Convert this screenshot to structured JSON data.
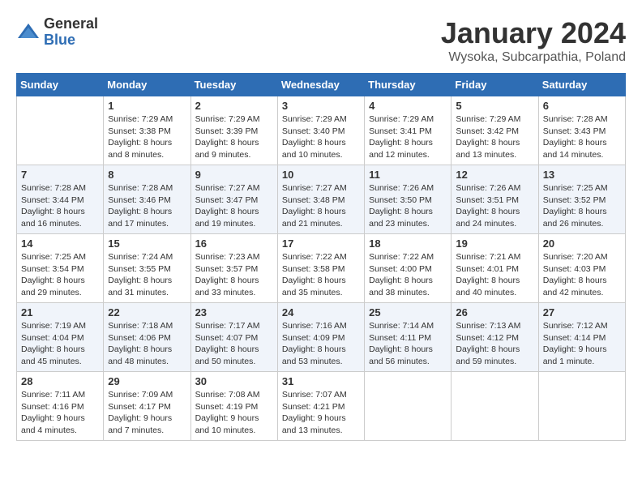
{
  "logo": {
    "general": "General",
    "blue": "Blue"
  },
  "title": {
    "month": "January 2024",
    "location": "Wysoka, Subcarpathia, Poland"
  },
  "weekdays": [
    "Sunday",
    "Monday",
    "Tuesday",
    "Wednesday",
    "Thursday",
    "Friday",
    "Saturday"
  ],
  "weeks": [
    {
      "days": [
        {
          "date": "",
          "info": ""
        },
        {
          "date": "1",
          "info": "Sunrise: 7:29 AM\nSunset: 3:38 PM\nDaylight: 8 hours\nand 8 minutes."
        },
        {
          "date": "2",
          "info": "Sunrise: 7:29 AM\nSunset: 3:39 PM\nDaylight: 8 hours\nand 9 minutes."
        },
        {
          "date": "3",
          "info": "Sunrise: 7:29 AM\nSunset: 3:40 PM\nDaylight: 8 hours\nand 10 minutes."
        },
        {
          "date": "4",
          "info": "Sunrise: 7:29 AM\nSunset: 3:41 PM\nDaylight: 8 hours\nand 12 minutes."
        },
        {
          "date": "5",
          "info": "Sunrise: 7:29 AM\nSunset: 3:42 PM\nDaylight: 8 hours\nand 13 minutes."
        },
        {
          "date": "6",
          "info": "Sunrise: 7:28 AM\nSunset: 3:43 PM\nDaylight: 8 hours\nand 14 minutes."
        }
      ]
    },
    {
      "days": [
        {
          "date": "7",
          "info": "Sunrise: 7:28 AM\nSunset: 3:44 PM\nDaylight: 8 hours\nand 16 minutes."
        },
        {
          "date": "8",
          "info": "Sunrise: 7:28 AM\nSunset: 3:46 PM\nDaylight: 8 hours\nand 17 minutes."
        },
        {
          "date": "9",
          "info": "Sunrise: 7:27 AM\nSunset: 3:47 PM\nDaylight: 8 hours\nand 19 minutes."
        },
        {
          "date": "10",
          "info": "Sunrise: 7:27 AM\nSunset: 3:48 PM\nDaylight: 8 hours\nand 21 minutes."
        },
        {
          "date": "11",
          "info": "Sunrise: 7:26 AM\nSunset: 3:50 PM\nDaylight: 8 hours\nand 23 minutes."
        },
        {
          "date": "12",
          "info": "Sunrise: 7:26 AM\nSunset: 3:51 PM\nDaylight: 8 hours\nand 24 minutes."
        },
        {
          "date": "13",
          "info": "Sunrise: 7:25 AM\nSunset: 3:52 PM\nDaylight: 8 hours\nand 26 minutes."
        }
      ]
    },
    {
      "days": [
        {
          "date": "14",
          "info": "Sunrise: 7:25 AM\nSunset: 3:54 PM\nDaylight: 8 hours\nand 29 minutes."
        },
        {
          "date": "15",
          "info": "Sunrise: 7:24 AM\nSunset: 3:55 PM\nDaylight: 8 hours\nand 31 minutes."
        },
        {
          "date": "16",
          "info": "Sunrise: 7:23 AM\nSunset: 3:57 PM\nDaylight: 8 hours\nand 33 minutes."
        },
        {
          "date": "17",
          "info": "Sunrise: 7:22 AM\nSunset: 3:58 PM\nDaylight: 8 hours\nand 35 minutes."
        },
        {
          "date": "18",
          "info": "Sunrise: 7:22 AM\nSunset: 4:00 PM\nDaylight: 8 hours\nand 38 minutes."
        },
        {
          "date": "19",
          "info": "Sunrise: 7:21 AM\nSunset: 4:01 PM\nDaylight: 8 hours\nand 40 minutes."
        },
        {
          "date": "20",
          "info": "Sunrise: 7:20 AM\nSunset: 4:03 PM\nDaylight: 8 hours\nand 42 minutes."
        }
      ]
    },
    {
      "days": [
        {
          "date": "21",
          "info": "Sunrise: 7:19 AM\nSunset: 4:04 PM\nDaylight: 8 hours\nand 45 minutes."
        },
        {
          "date": "22",
          "info": "Sunrise: 7:18 AM\nSunset: 4:06 PM\nDaylight: 8 hours\nand 48 minutes."
        },
        {
          "date": "23",
          "info": "Sunrise: 7:17 AM\nSunset: 4:07 PM\nDaylight: 8 hours\nand 50 minutes."
        },
        {
          "date": "24",
          "info": "Sunrise: 7:16 AM\nSunset: 4:09 PM\nDaylight: 8 hours\nand 53 minutes."
        },
        {
          "date": "25",
          "info": "Sunrise: 7:14 AM\nSunset: 4:11 PM\nDaylight: 8 hours\nand 56 minutes."
        },
        {
          "date": "26",
          "info": "Sunrise: 7:13 AM\nSunset: 4:12 PM\nDaylight: 8 hours\nand 59 minutes."
        },
        {
          "date": "27",
          "info": "Sunrise: 7:12 AM\nSunset: 4:14 PM\nDaylight: 9 hours\nand 1 minute."
        }
      ]
    },
    {
      "days": [
        {
          "date": "28",
          "info": "Sunrise: 7:11 AM\nSunset: 4:16 PM\nDaylight: 9 hours\nand 4 minutes."
        },
        {
          "date": "29",
          "info": "Sunrise: 7:09 AM\nSunset: 4:17 PM\nDaylight: 9 hours\nand 7 minutes."
        },
        {
          "date": "30",
          "info": "Sunrise: 7:08 AM\nSunset: 4:19 PM\nDaylight: 9 hours\nand 10 minutes."
        },
        {
          "date": "31",
          "info": "Sunrise: 7:07 AM\nSunset: 4:21 PM\nDaylight: 9 hours\nand 13 minutes."
        },
        {
          "date": "",
          "info": ""
        },
        {
          "date": "",
          "info": ""
        },
        {
          "date": "",
          "info": ""
        }
      ]
    }
  ]
}
